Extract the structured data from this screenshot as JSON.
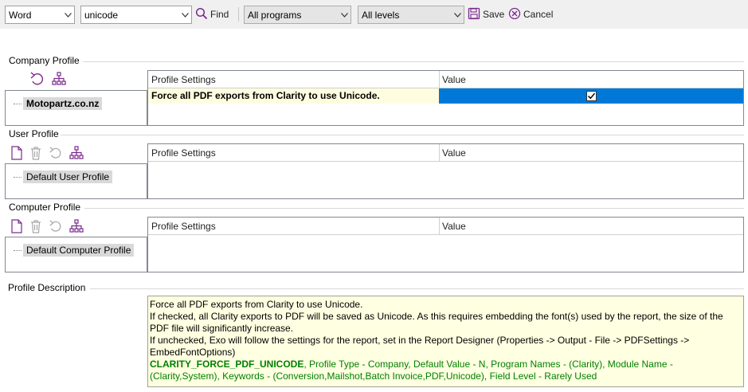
{
  "toolbar": {
    "mode": "Word",
    "search_value": "unicode",
    "find_label": "Find",
    "programs": "All programs",
    "levels": "All levels",
    "save_label": "Save",
    "cancel_label": "Cancel"
  },
  "company": {
    "title": "Company Profile",
    "tree_item": "Motopartz.co.nz",
    "col1": "Profile Settings",
    "col2": "Value",
    "rows": [
      {
        "setting": "Force all PDF exports from Clarity to use Unicode.",
        "checked": true
      }
    ]
  },
  "user": {
    "title": "User Profile",
    "tree_item": "Default User Profile",
    "col1": "Profile Settings",
    "col2": "Value"
  },
  "computer": {
    "title": "Computer Profile",
    "tree_item": "Default Computer Profile",
    "col1": "Profile Settings",
    "col2": "Value"
  },
  "description": {
    "title": "Profile Description",
    "line1": "Force all PDF exports from Clarity to use Unicode.",
    "line2": "If checked, all Clarity exports to PDF will be saved as Unicode. As this requires embedding the font(s) used by the report, the size of the PDF file will significantly increase.",
    "line3": "If unchecked, Exo will follow the settings for the report, set in the Report Designer (Properties -> Output - File -> PDFSettings -> EmbedFontOptions)",
    "key_name": "CLARITY_FORCE_PDF_UNICODE",
    "key_details": ", Profile Type - Company, Default Value - N, Program Names - (Clarity), Module Name - (Clarity,System), Keywords - (Conversion,Mailshot,Batch Invoice,PDF,Unicode), Field Level - Rarely Used"
  },
  "colors": {
    "selection": "#0078d7",
    "row_highlight": "#fffde0",
    "description_bg": "#ffffe1",
    "description_key": "#008000",
    "icon_purple": "#7a2a8c"
  }
}
